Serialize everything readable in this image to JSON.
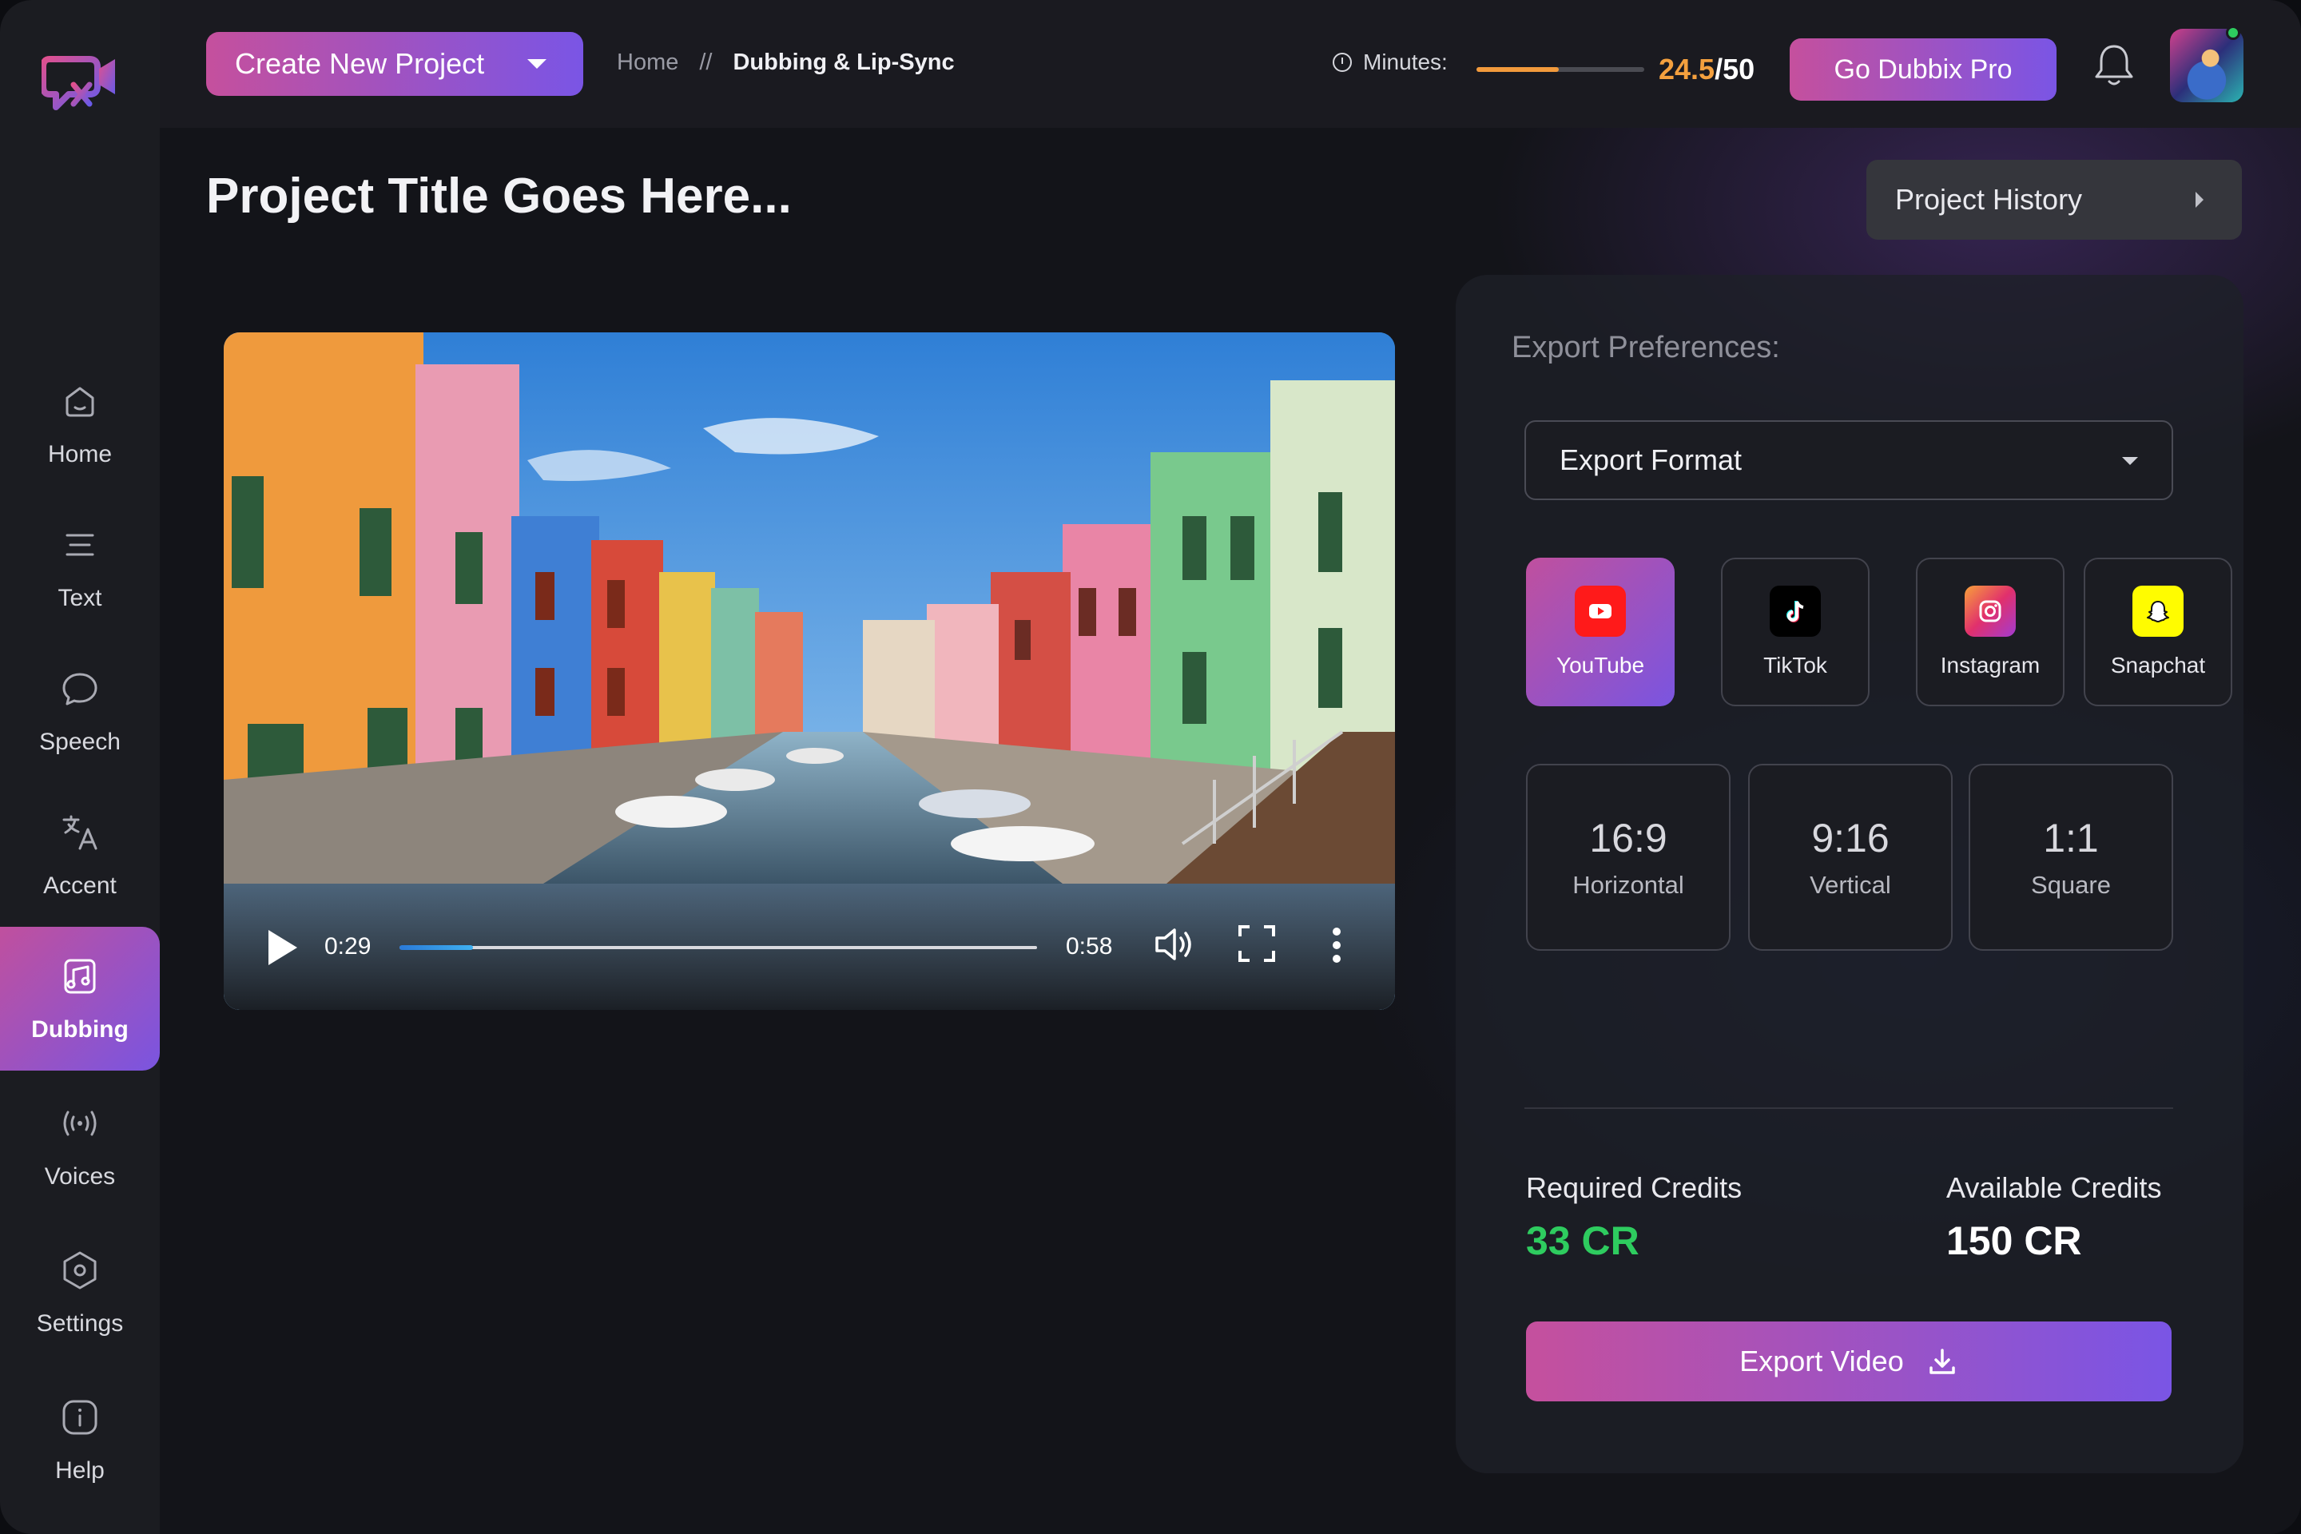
{
  "sidebar": {
    "items": [
      {
        "label": "Home",
        "icon": "home-icon"
      },
      {
        "label": "Text",
        "icon": "text-lines-icon"
      },
      {
        "label": "Speech",
        "icon": "speech-bubble-icon"
      },
      {
        "label": "Accent",
        "icon": "translate-icon"
      },
      {
        "label": "Dubbing",
        "icon": "music-notes-icon",
        "active": true
      },
      {
        "label": "Voices",
        "icon": "broadcast-icon"
      },
      {
        "label": "Settings",
        "icon": "hexagon-gear-icon"
      },
      {
        "label": "Help",
        "icon": "info-icon"
      }
    ]
  },
  "header": {
    "create_label": "Create New Project",
    "breadcrumb": {
      "home": "Home",
      "sep": "//",
      "current": "Dubbing & Lip-Sync"
    },
    "minutes_label": "Minutes:",
    "minutes_used": "24.5",
    "minutes_total": "/50",
    "minutes_fraction": 0.49,
    "pro_label": "Go Dubbix Pro"
  },
  "page": {
    "title": "Project Title Goes Here...",
    "history_label": "Project History"
  },
  "player": {
    "current_time": "0:29",
    "duration": "0:58",
    "progress_fraction": 0.115
  },
  "export": {
    "title": "Export Preferences:",
    "format_placeholder": "Export Format",
    "platforms": [
      {
        "label": "YouTube",
        "icon": "youtube-icon",
        "color": "#ff0000",
        "active": true
      },
      {
        "label": "TikTok",
        "icon": "tiktok-icon",
        "color": "#000000"
      },
      {
        "label": "Instagram",
        "icon": "instagram-icon",
        "color": "#e1306c"
      },
      {
        "label": "Snapchat",
        "icon": "snapchat-icon",
        "color": "#fffc00"
      }
    ],
    "ratios": [
      {
        "ratio": "16:9",
        "name": "Horizontal"
      },
      {
        "ratio": "9:16",
        "name": "Vertical"
      },
      {
        "ratio": "1:1",
        "name": "Square"
      }
    ],
    "required_label": "Required Credits",
    "required_value": "33 CR",
    "available_label": "Available Credits",
    "available_value": "150 CR",
    "export_label": "Export Video"
  },
  "colors": {
    "accent_start": "#c5509d",
    "accent_end": "#7a55e5",
    "minutes_bar": "#f29a3c",
    "required_credits": "#2ecc5f"
  }
}
